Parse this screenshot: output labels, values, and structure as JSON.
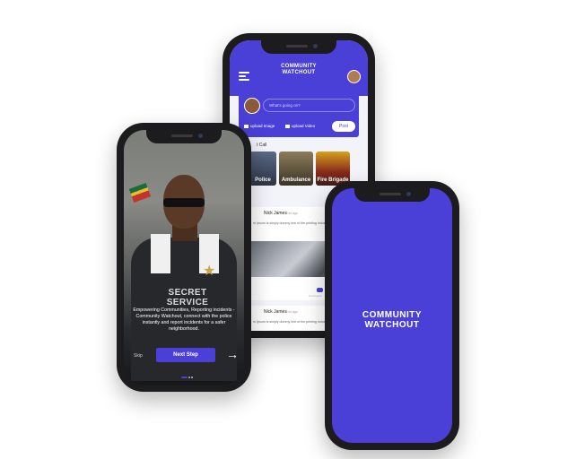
{
  "feed_screen": {
    "brand": {
      "line1": "COMMUNITY",
      "line2": "WATCHOUT"
    },
    "composer": {
      "placeholder": "What's going on?",
      "upload_image": "upload Image",
      "upload_video": "upload Video",
      "post": "Post"
    },
    "section_title": "t Call",
    "categories": [
      {
        "label": "Police"
      },
      {
        "label": "Ambulance"
      },
      {
        "label": "Fire Brigade"
      }
    ],
    "posts": [
      {
        "name": "Nick James",
        "time": "1hr ago",
        "text": "m Ipsum is simply dummy text of the printing industry world this",
        "comments": "Comments"
      },
      {
        "name": "Nick James",
        "time": "1hr ago",
        "text": "m Ipsum is simply dummy text of the printing industry world this"
      }
    ]
  },
  "onboarding_screen": {
    "vest_text": {
      "line1": "SECRET",
      "line2": "SERVICE"
    },
    "caption": "Empowering Communities, Reporting incidents - Community Watchout, connect with the police instantly and report incidents for a safer neighborhood.",
    "skip": "Skip",
    "next": "Next Step",
    "arrow": "→"
  },
  "splash_screen": {
    "brand": {
      "line1": "COMMUNITY",
      "line2": "WATCHOUT"
    }
  },
  "colors": {
    "brand": "#4a3fd6",
    "phone_frame": "#1c1c1e"
  }
}
